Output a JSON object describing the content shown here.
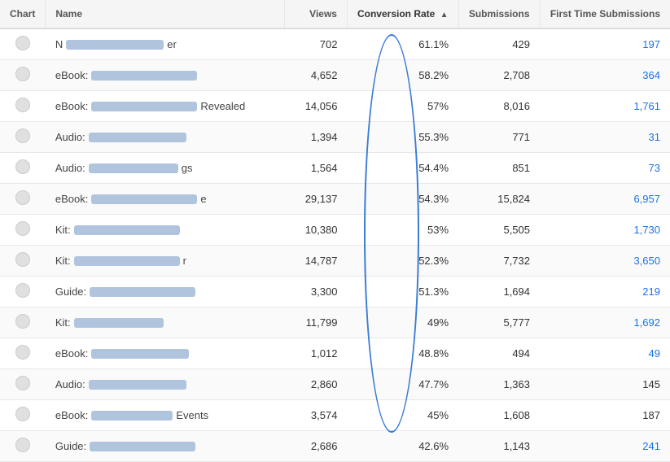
{
  "table": {
    "columns": [
      {
        "key": "chart",
        "label": "Chart"
      },
      {
        "key": "name",
        "label": "Name"
      },
      {
        "key": "views",
        "label": "Views"
      },
      {
        "key": "conversionRate",
        "label": "Conversion Rate",
        "sorted": "asc"
      },
      {
        "key": "submissions",
        "label": "Submissions"
      },
      {
        "key": "firstTimeSubmissions",
        "label": "First Time Submissions"
      }
    ],
    "rows": [
      {
        "id": 1,
        "namePrefix": "N",
        "nameSuffix": "er",
        "blurWidth": 120,
        "views": "702",
        "conversionRate": "61.1%",
        "submissions": "429",
        "firstTimeSubmissions": "197",
        "firstLink": true
      },
      {
        "id": 2,
        "namePrefix": "eBook:",
        "nameSuffix": "",
        "blurWidth": 130,
        "views": "4,652",
        "conversionRate": "58.2%",
        "submissions": "2,708",
        "firstTimeSubmissions": "364",
        "firstLink": true
      },
      {
        "id": 3,
        "namePrefix": "eBook:",
        "nameSuffix": "Revealed",
        "blurWidth": 130,
        "views": "14,056",
        "conversionRate": "57%",
        "submissions": "8,016",
        "firstTimeSubmissions": "1,761",
        "firstLink": true
      },
      {
        "id": 4,
        "namePrefix": "Audio:",
        "nameSuffix": "",
        "blurWidth": 120,
        "views": "1,394",
        "conversionRate": "55.3%",
        "submissions": "771",
        "firstTimeSubmissions": "31",
        "firstLink": true
      },
      {
        "id": 5,
        "namePrefix": "Audio:",
        "nameSuffix": "gs",
        "blurWidth": 110,
        "views": "1,564",
        "conversionRate": "54.4%",
        "submissions": "851",
        "firstTimeSubmissions": "73",
        "firstLink": true
      },
      {
        "id": 6,
        "namePrefix": "eBook:",
        "nameSuffix": "e",
        "blurWidth": 130,
        "views": "29,137",
        "conversionRate": "54.3%",
        "submissions": "15,824",
        "firstTimeSubmissions": "6,957",
        "firstLink": true
      },
      {
        "id": 7,
        "namePrefix": "Kit:",
        "nameSuffix": "",
        "blurWidth": 130,
        "views": "10,380",
        "conversionRate": "53%",
        "submissions": "5,505",
        "firstTimeSubmissions": "1,730",
        "firstLink": true
      },
      {
        "id": 8,
        "namePrefix": "Kit:",
        "nameSuffix": "r",
        "blurWidth": 130,
        "views": "14,787",
        "conversionRate": "52.3%",
        "submissions": "7,732",
        "firstTimeSubmissions": "3,650",
        "firstLink": true
      },
      {
        "id": 9,
        "namePrefix": "Guide:",
        "nameSuffix": "",
        "blurWidth": 130,
        "views": "3,300",
        "conversionRate": "51.3%",
        "submissions": "1,694",
        "firstTimeSubmissions": "219",
        "firstLink": true
      },
      {
        "id": 10,
        "namePrefix": "Kit:",
        "nameSuffix": "",
        "blurWidth": 110,
        "views": "11,799",
        "conversionRate": "49%",
        "submissions": "5,777",
        "firstTimeSubmissions": "1,692",
        "firstLink": true
      },
      {
        "id": 11,
        "namePrefix": "eBook:",
        "nameSuffix": "",
        "blurWidth": 120,
        "views": "1,012",
        "conversionRate": "48.8%",
        "submissions": "494",
        "firstTimeSubmissions": "49",
        "firstLink": true
      },
      {
        "id": 12,
        "namePrefix": "Audio:",
        "nameSuffix": "",
        "blurWidth": 120,
        "views": "2,860",
        "conversionRate": "47.7%",
        "submissions": "1,363",
        "firstTimeSubmissions": "145",
        "firstLink": false
      },
      {
        "id": 13,
        "namePrefix": "eBook:",
        "nameSuffix": "Events",
        "blurWidth": 100,
        "views": "3,574",
        "conversionRate": "45%",
        "submissions": "1,608",
        "firstTimeSubmissions": "187",
        "firstLink": false
      },
      {
        "id": 14,
        "namePrefix": "Guide:",
        "nameSuffix": "",
        "blurWidth": 130,
        "views": "2,686",
        "conversionRate": "42.6%",
        "submissions": "1,143",
        "firstTimeSubmissions": "241",
        "firstLink": true
      }
    ]
  }
}
